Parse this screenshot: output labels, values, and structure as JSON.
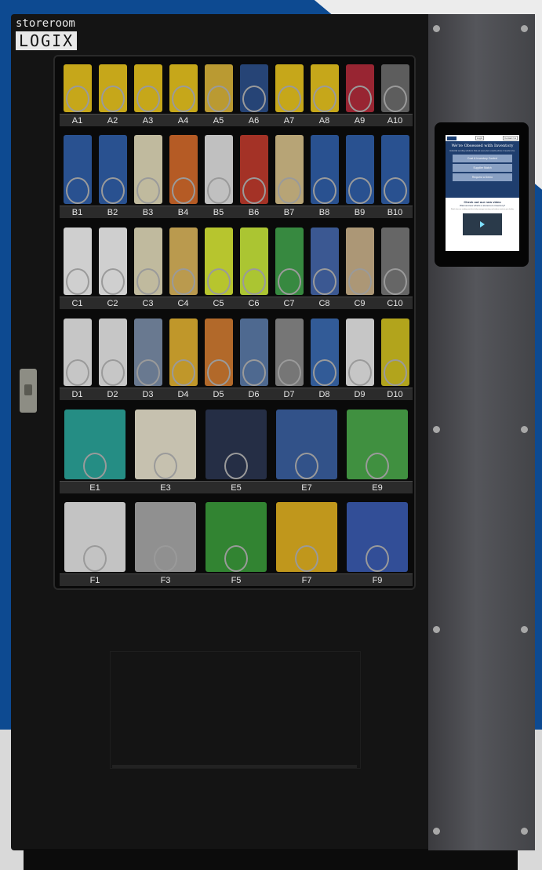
{
  "brand": {
    "top": "storeroom",
    "box": "LOGIX"
  },
  "screen": {
    "nav_btn_1": "Login",
    "nav_btn_2": "Contact Us",
    "hero_title": "We're Obsessed with Inventory",
    "hero_sub": "Industrial vending solutions that put every item exactly where it needs to be.",
    "buttons": [
      "Cost & Inventory Control",
      "Supplier Match",
      "Request a Demo"
    ],
    "video_heading": "Check out our new video",
    "video_subheading": "Wanna know what's a storeroom inventory?",
    "video_text": "Watch how our vending machines help manage inventory and reduce waste in your facility."
  },
  "rows": [
    {
      "id": "A",
      "labels": [
        "A1",
        "A2",
        "A3",
        "A4",
        "A5",
        "A6",
        "A7",
        "A8",
        "A9",
        "A10"
      ],
      "colors": [
        "#e8c31d",
        "#e8c31d",
        "#e8c31d",
        "#e8c31d",
        "#d9b43a",
        "#2b4f8a",
        "#e8c31d",
        "#e8c31d",
        "#b22a3a",
        "#6c6c6c"
      ]
    },
    {
      "id": "B",
      "labels": [
        "B1",
        "B2",
        "B3",
        "B4",
        "B5",
        "B6",
        "B7",
        "B8",
        "B9",
        "B10"
      ],
      "colors": [
        "#2f5ea8",
        "#2f5ea8",
        "#e0d9b8",
        "#d36a2a",
        "#e0e0e0",
        "#c0392b",
        "#d6c08a",
        "#2f5ea8",
        "#2f5ea8",
        "#2f5ea8"
      ]
    },
    {
      "id": "C",
      "labels": [
        "C1",
        "C2",
        "C3",
        "C4",
        "C5",
        "C6",
        "C7",
        "C8",
        "C9",
        "C10"
      ],
      "colors": [
        "#f2f2f2",
        "#f2f2f2",
        "#e0d9b8",
        "#d9b45a",
        "#d6e635",
        "#c8e63a",
        "#3fa04a",
        "#4466aa",
        "#c9b08a",
        "#777777"
      ]
    },
    {
      "id": "D",
      "labels": [
        "D1",
        "D2",
        "D3",
        "D4",
        "D5",
        "D6",
        "D7",
        "D8",
        "D9",
        "D10"
      ],
      "colors": [
        "#e8e8e8",
        "#e8e8e8",
        "#7a8da8",
        "#e0b030",
        "#d07a30",
        "#5a7aa8",
        "#8a8a8a",
        "#3a6ab0",
        "#e8e8e8",
        "#d0c020"
      ]
    },
    {
      "id": "E",
      "labels": [
        "E1",
        "E3",
        "E5",
        "E7",
        "E9"
      ],
      "colors": [
        "#2aa59a",
        "#e8e2cc",
        "#2a3550",
        "#3a5fa0",
        "#4aa84a"
      ]
    },
    {
      "id": "F",
      "labels": [
        "F1",
        "F3",
        "F5",
        "F7",
        "F9"
      ],
      "colors": [
        "#e4e4e4",
        "#a8a8a8",
        "#3a9a3a",
        "#e0b020",
        "#3a5ab0"
      ]
    }
  ]
}
